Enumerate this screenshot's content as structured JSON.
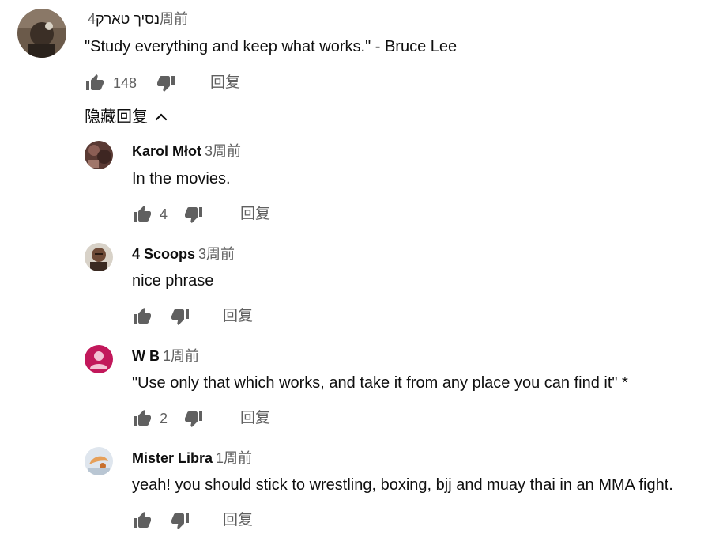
{
  "top_comment": {
    "author": "נסיך טארק",
    "time": "4周前",
    "text": "\"Study everything and keep what works.\" - Bruce Lee",
    "likes": "148",
    "reply_label": "回复",
    "avatar_icon": "user-avatar-photo"
  },
  "replies_toggle": {
    "label": "隐藏回复",
    "icon": "chevron-up-icon"
  },
  "replies": [
    {
      "author": "Karol Młot",
      "time": "3周前",
      "text": "In the movies.",
      "likes": "4",
      "reply_label": "回复"
    },
    {
      "author": "4 Scoops",
      "time": "3周前",
      "text": "nice phrase",
      "likes": "",
      "reply_label": "回复"
    },
    {
      "author": "W B",
      "time": "1周前",
      "text": "\"Use only that which works, and take it from any place you can find it\" *",
      "likes": "2",
      "reply_label": "回复"
    },
    {
      "author": "Mister Libra",
      "time": "1周前",
      "text": "yeah! you should stick to wrestling, boxing, bjj and muay thai in an MMA fight.",
      "likes": "",
      "reply_label": "回复"
    }
  ],
  "colors": {
    "secondary_text": "#606060",
    "primary_text": "#0f0f0f",
    "default_avatar_bg": "#c2185b"
  }
}
